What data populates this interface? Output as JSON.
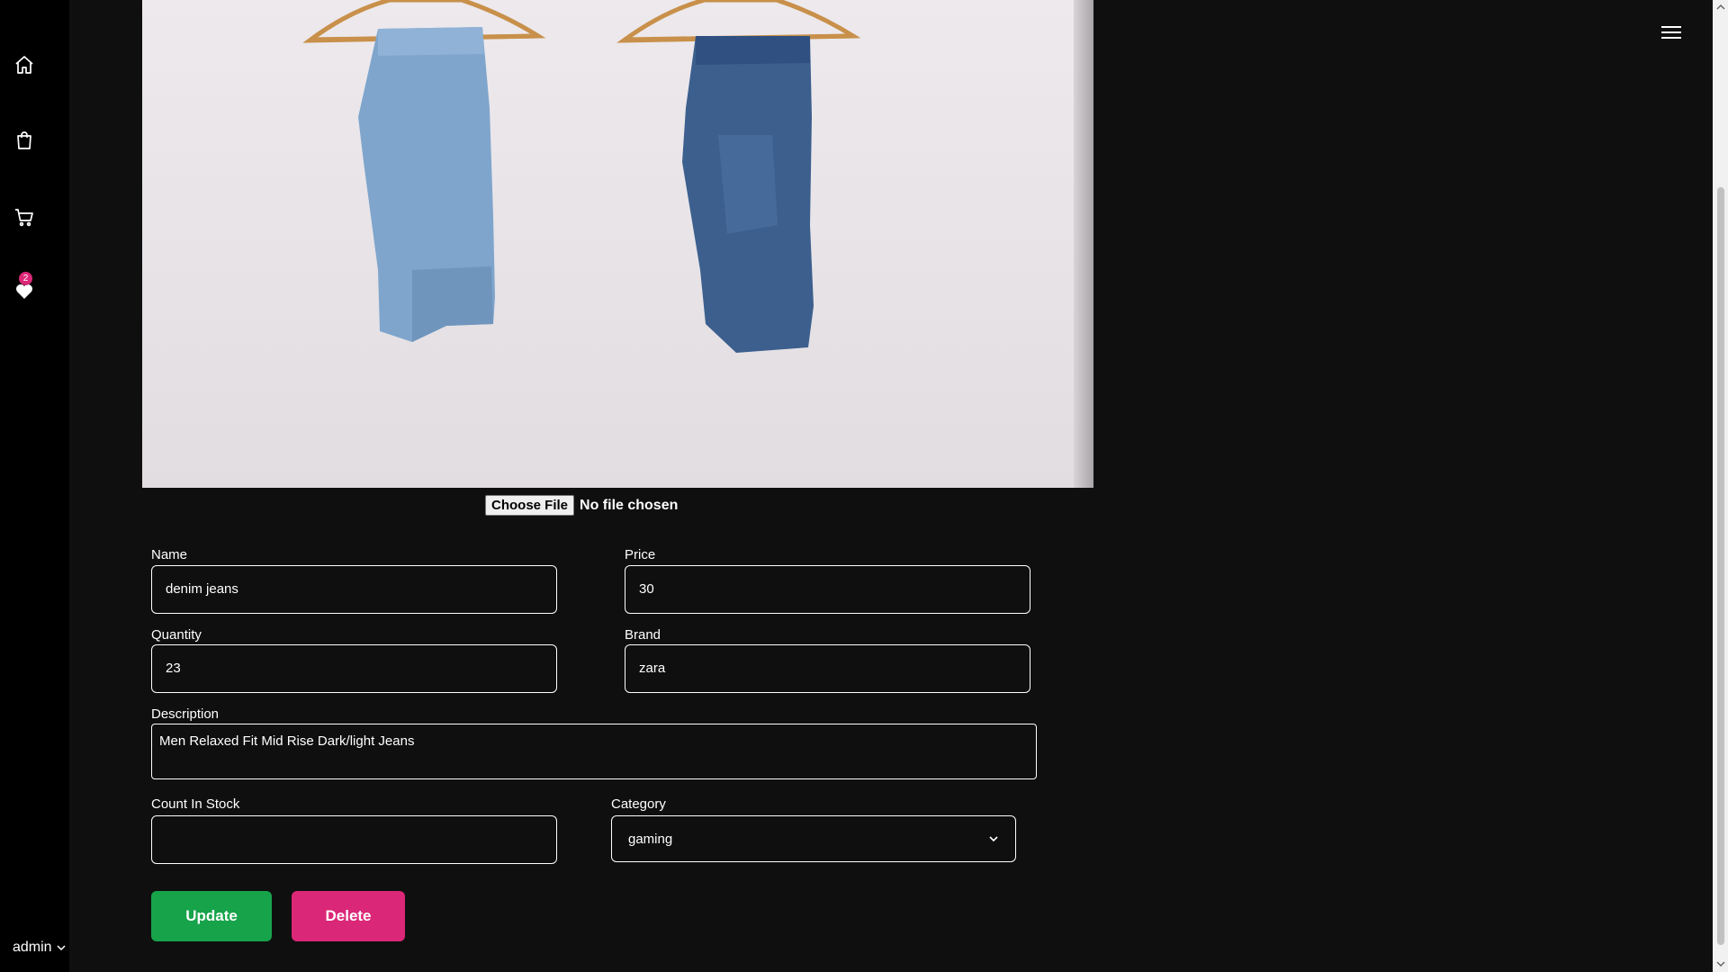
{
  "sidebar": {
    "items": [
      {
        "icon": "home-icon"
      },
      {
        "icon": "shopping-bag-icon"
      },
      {
        "icon": "cart-icon"
      },
      {
        "icon": "heart-icon",
        "badge": "2"
      }
    ],
    "user_label": "admin"
  },
  "image": {
    "file_button_label": "Choose File",
    "file_status": "No file chosen"
  },
  "form": {
    "name_label": "Name",
    "name_value": "denim jeans",
    "price_label": "Price",
    "price_value": "30",
    "quantity_label": "Quantity",
    "quantity_value": "23",
    "brand_label": "Brand",
    "brand_value": "zara",
    "description_label": "Description",
    "description_value": "Men Relaxed Fit Mid Rise Dark/light Jeans",
    "count_label": "Count In Stock",
    "count_value": "",
    "category_label": "Category",
    "category_value": "gaming",
    "update_label": "Update",
    "delete_label": "Delete"
  },
  "colors": {
    "update": "#16a34a",
    "delete": "#db2777",
    "background": "#0f0f10",
    "sidebar": "#000000"
  }
}
